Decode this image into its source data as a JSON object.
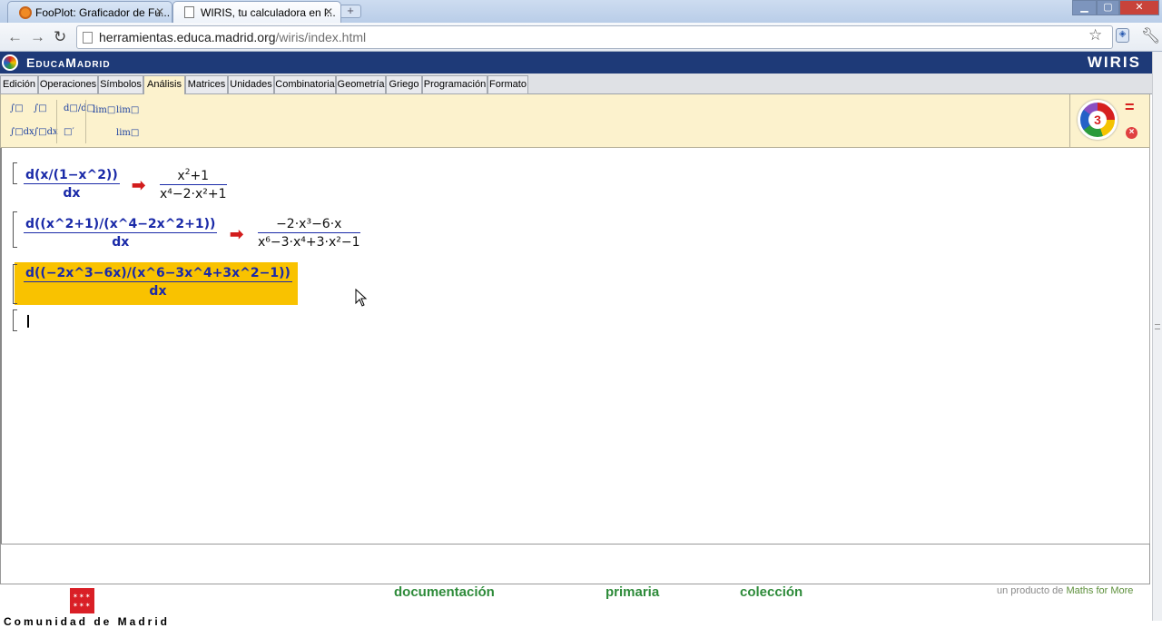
{
  "browser": {
    "tabs": [
      {
        "title": "FooPlot: Graficador de Fu...",
        "active": false,
        "favicon": "fooplot-favicon"
      },
      {
        "title": "WIRIS, tu calculadora en l...",
        "active": true,
        "favicon": "page-icon"
      }
    ],
    "new_tab_label": "+",
    "address": {
      "host": "herramientas.educa.madrid.org",
      "path": "/wiris/index.html"
    }
  },
  "header": {
    "site_name": "EducaMadrid",
    "product_logo": "WIRIS"
  },
  "menu_tabs": [
    "Edición",
    "Operaciones",
    "Símbolos",
    "Análisis",
    "Matrices",
    "Unidades",
    "Combinatoria",
    "Geometría",
    "Griego",
    "Programación",
    "Formato"
  ],
  "active_menu_tab": "Análisis",
  "palette": {
    "integral": "∫□",
    "integral_range": "∫□",
    "definite_integral": "∫□dx",
    "definite_integral_range": "∫□dx",
    "derivative": "d□/d□",
    "prime": "□′",
    "limit": "lim□",
    "limit_alt": "lim□",
    "limit_alt2": "lim□",
    "evaluate": "=",
    "close": "×"
  },
  "expressions": [
    {
      "input_num": "d(x/(1−x^2))",
      "input_den": "dx",
      "result_num": [
        "x",
        "2",
        "+1"
      ],
      "result_den": "x⁴−2·x²+1"
    },
    {
      "input_num": "d((x^2+1)/(x^4−2x^2+1))",
      "input_den": "dx",
      "result_num": "−2·x³−6·x",
      "result_den": "x⁶−3·x⁴+3·x²−1"
    },
    {
      "input_num": "d((−2x^3−6x)/(x^6−3x^4+3x^2−1))",
      "input_den": "dx"
    }
  ],
  "footer": {
    "links": [
      "documentación",
      "primaria",
      "colección"
    ],
    "credit_prefix": "un producto de",
    "credit_brand": "Maths for More",
    "org_text": "Comunidad de Madrid"
  },
  "colors": {
    "header_bg": "#1e3a78",
    "palette_bg": "#fcf2cd",
    "highlight": "#f9c200",
    "math_blue": "#1a2aa8",
    "arrow_red": "#d21c1c",
    "link_green": "#2e8b3a"
  }
}
